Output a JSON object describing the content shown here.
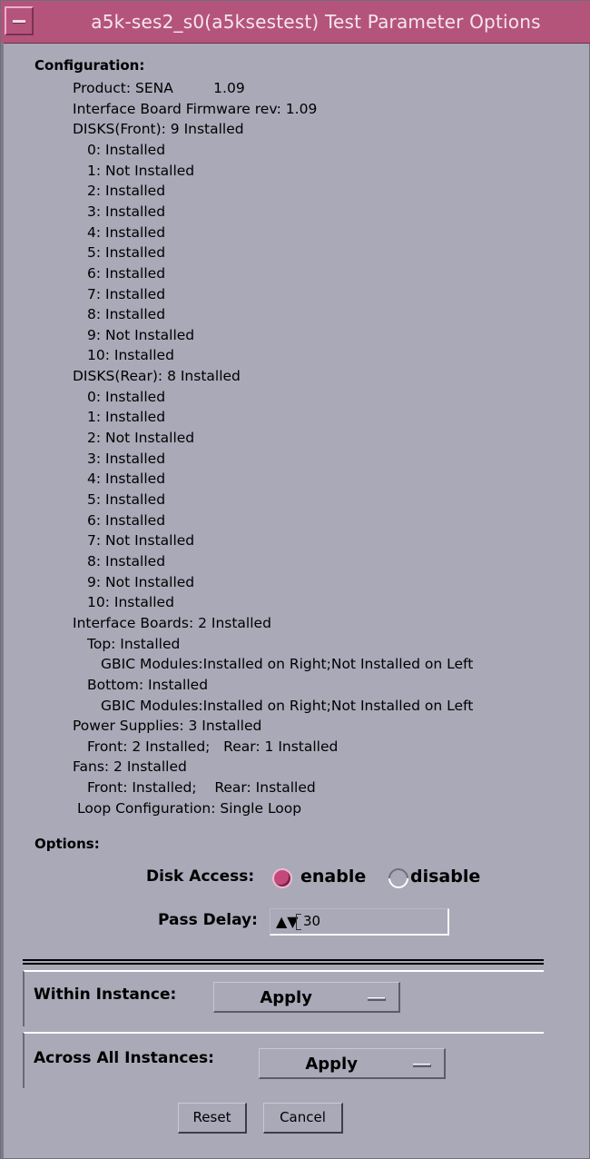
{
  "window": {
    "title": "a5k-ses2_s0(a5ksestest) Test Parameter Options"
  },
  "configuration": {
    "heading": "Configuration:",
    "lines": [
      "Product: SENA         1.09",
      "Interface Board Firmware rev: 1.09",
      "DISKS(Front): 9 Installed",
      "0: Installed",
      "1: Not Installed",
      "2: Installed",
      "3: Installed",
      "4: Installed",
      "5: Installed",
      "6: Installed",
      "7: Installed",
      "8: Installed",
      "9: Not Installed",
      "10: Installed",
      "DISKS(Rear): 8 Installed",
      "0: Installed",
      "1: Installed",
      "2: Not Installed",
      "3: Installed",
      "4: Installed",
      "5: Installed",
      "6: Installed",
      "7: Not Installed",
      "8: Installed",
      "9: Not Installed",
      "10: Installed",
      "Interface Boards: 2 Installed",
      "Top: Installed",
      "GBIC Modules:Installed on Right;Not Installed on Left",
      "Bottom: Installed",
      "GBIC Modules:Installed on Right;Not Installed on Left",
      "Power Supplies: 3 Installed",
      "Front: 2 Installed;   Rear: 1 Installed",
      "Fans: 2 Installed",
      "Front: Installed;    Rear: Installed",
      "Loop Configuration: Single Loop"
    ]
  },
  "options": {
    "heading": "Options:",
    "disk_access": {
      "label": "Disk Access:",
      "choices": [
        "enable",
        "disable"
      ],
      "selected": "enable"
    },
    "pass_delay": {
      "label": "Pass Delay:",
      "arrows": "▲▼",
      "value": "30"
    }
  },
  "within_instance": {
    "label": "Within Instance:",
    "button": "Apply"
  },
  "across_instances": {
    "label": "Across All Instances:",
    "button": "Apply"
  },
  "buttons": {
    "reset": "Reset",
    "cancel": "Cancel"
  },
  "colors": {
    "titlebar": "#b5547a",
    "background": "#a9a9b8",
    "radio_selected": "#c4497a"
  }
}
